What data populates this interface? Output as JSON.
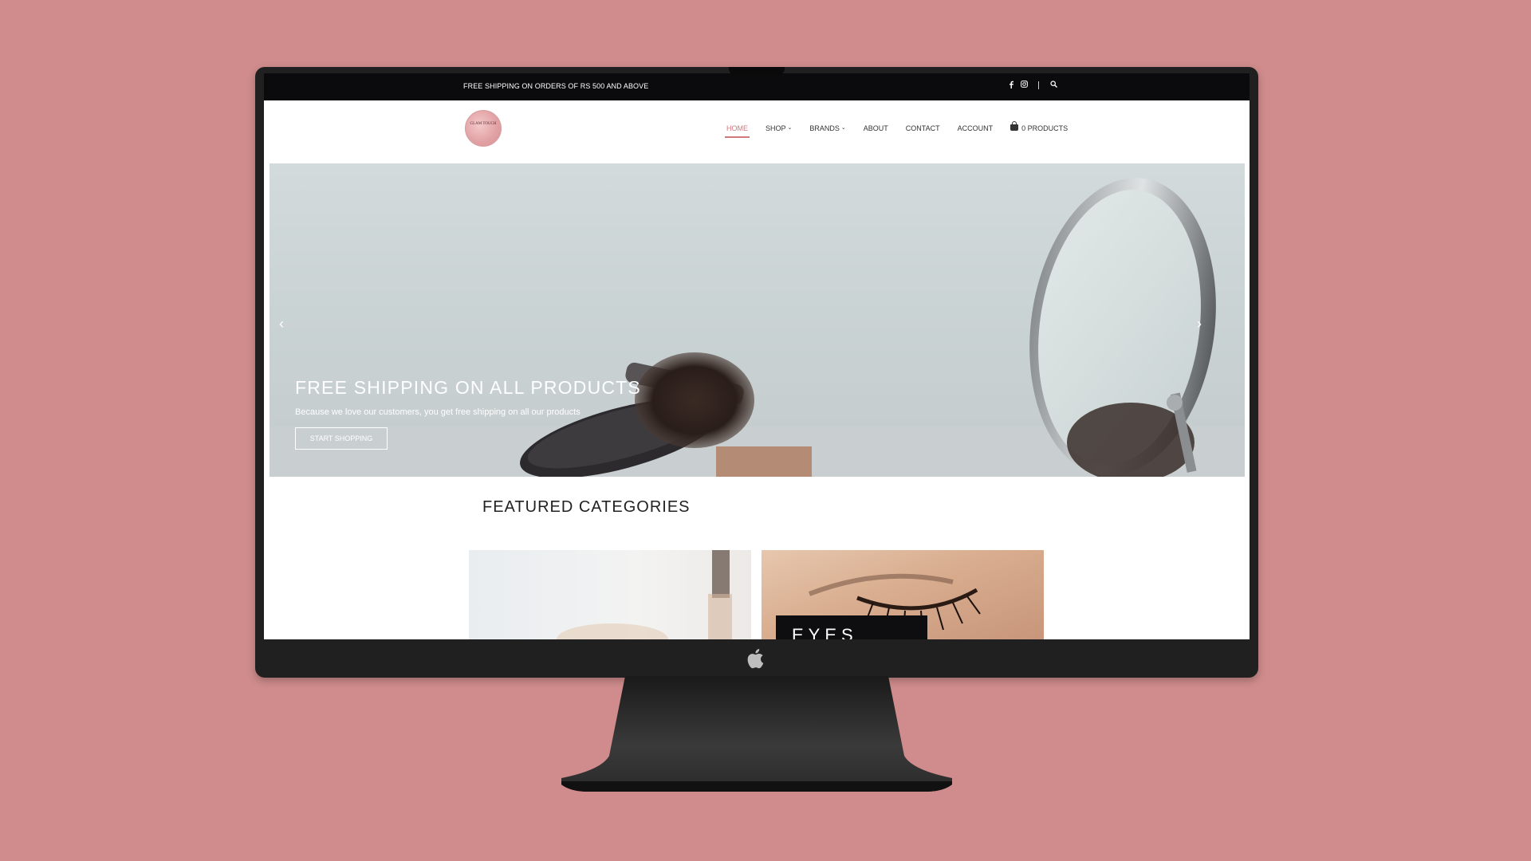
{
  "topbar": {
    "promo": "FREE SHIPPING ON ORDERS OF RS 500 AND ABOVE",
    "icons": [
      "facebook-icon",
      "instagram-icon",
      "search-icon"
    ]
  },
  "header": {
    "logo_text": "GLAM TOUCH",
    "nav": [
      {
        "label": "HOME",
        "active": true
      },
      {
        "label": "SHOP",
        "dropdown": true
      },
      {
        "label": "BRANDS",
        "dropdown": true
      },
      {
        "label": "ABOUT"
      },
      {
        "label": "CONTACT"
      },
      {
        "label": "ACCOUNT"
      }
    ],
    "cart_label": "0 PRODUCTS"
  },
  "hero": {
    "title": "FREE SHIPPING ON ALL PRODUCTS",
    "subtitle": "Because we love our customers, you get free shipping on all our products",
    "button": "START SHOPPING",
    "prev": "‹",
    "next": "›"
  },
  "featured": {
    "title": "FEATURED CATEGORIES",
    "categories": [
      {
        "label": ""
      },
      {
        "label": "EYES"
      }
    ]
  },
  "colors": {
    "background": "#d08c8c",
    "accent": "#d0787c",
    "topbar": "#0b0b0d"
  }
}
